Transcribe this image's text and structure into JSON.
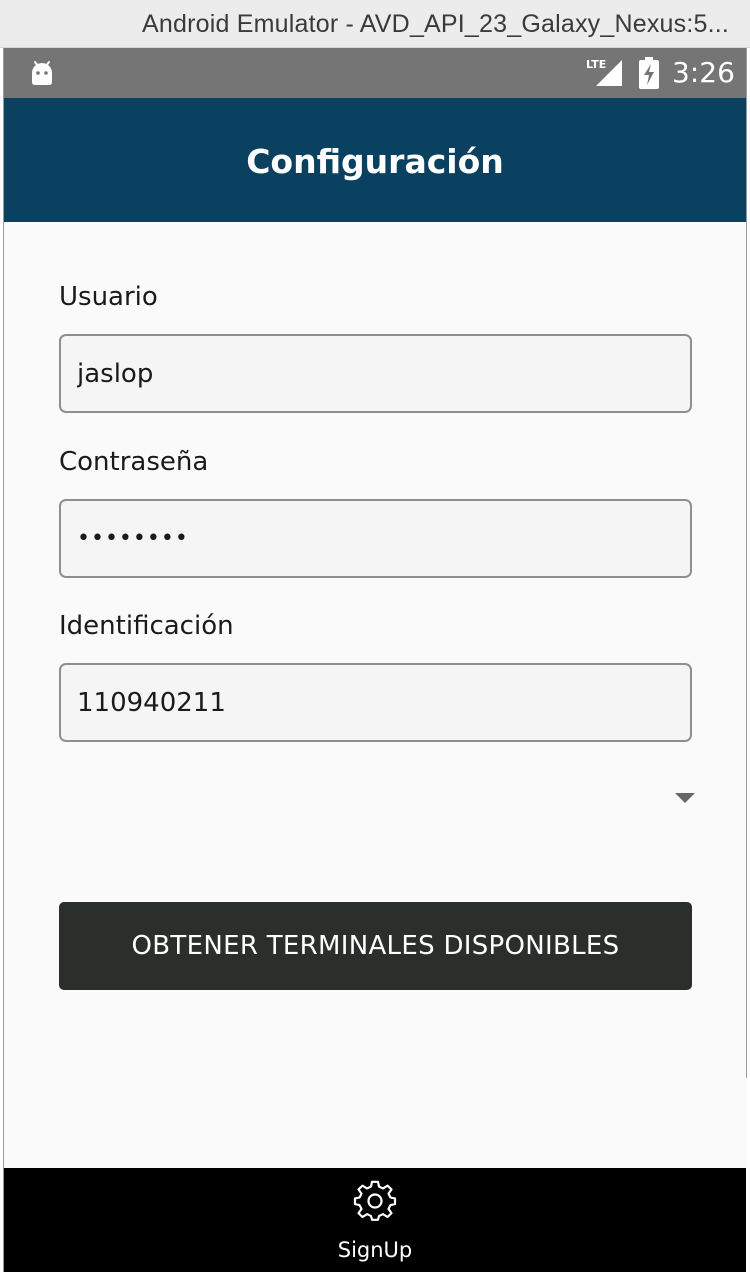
{
  "window": {
    "title": "Android Emulator - AVD_API_23_Galaxy_Nexus:5..."
  },
  "status_bar": {
    "time": "3:26",
    "network": "LTE",
    "icons": [
      "android-icon",
      "lte-signal-icon",
      "battery-charging-icon"
    ]
  },
  "app_bar": {
    "title": "Configuración",
    "color": "#0b4160"
  },
  "form": {
    "user": {
      "label": "Usuario",
      "value": "jaslop"
    },
    "password": {
      "label": "Contraseña",
      "value": "••••••••"
    },
    "identification": {
      "label": "Identificación",
      "value": "110940211"
    },
    "picker": {
      "selected": "",
      "icon": "dropdown-arrow-icon"
    },
    "submit_label": "OBTENER TERMINALES DISPONIBLES"
  },
  "tab_bar": {
    "tabs": [
      {
        "label": "SignUp",
        "icon": "gear-icon"
      }
    ]
  },
  "colors": {
    "app_bar": "#0b4160",
    "button": "#2b2f2c",
    "tab_bar": "#000000",
    "status_bar": "#757575"
  }
}
